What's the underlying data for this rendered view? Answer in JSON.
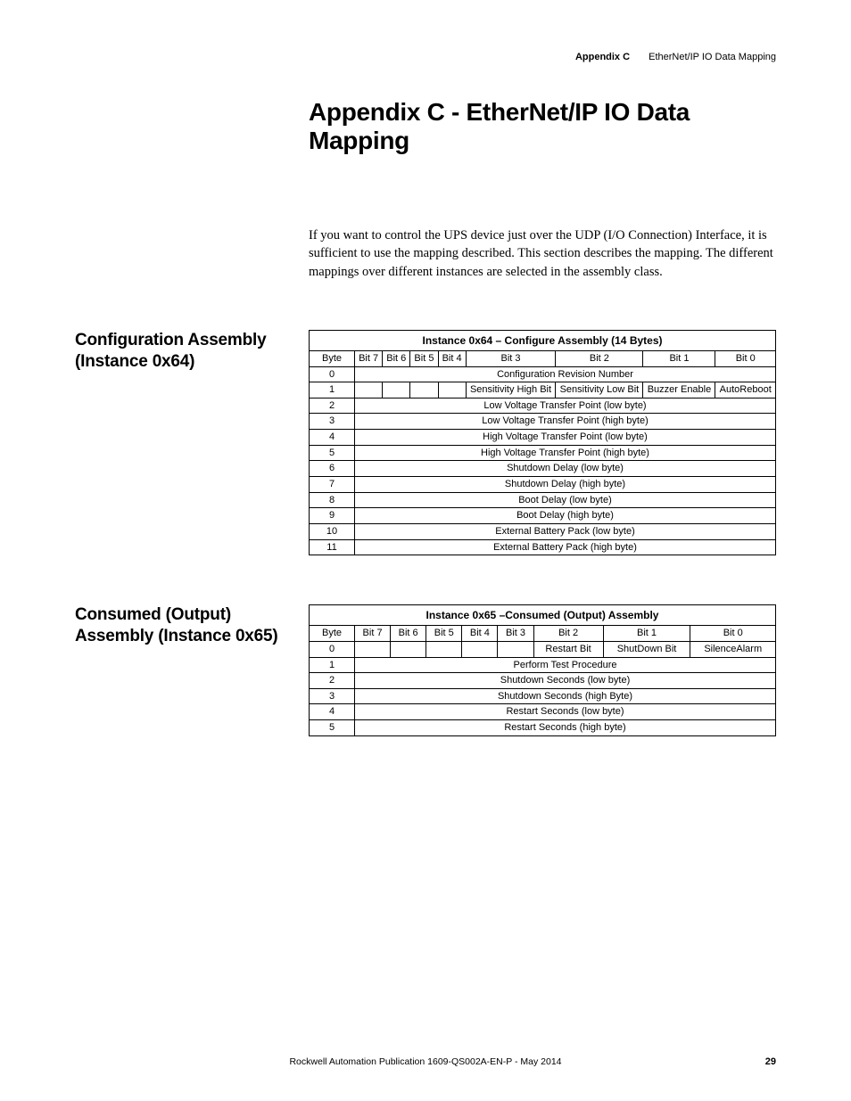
{
  "header": {
    "appendix": "Appendix C",
    "chapter": "EtherNet/IP IO Data Mapping"
  },
  "title": "Appendix C - EtherNet/IP IO Data Mapping",
  "intro": "If you want to control the UPS device just over the UDP (I/O Connection) Interface, it is sufficient to use the mapping described. This section describes the mapping. The different mappings over different instances are selected in the assembly class.",
  "section1": {
    "heading": "Configuration Assembly (Instance 0x64)",
    "table": {
      "caption": "Instance 0x64 – Configure Assembly (14 Bytes)",
      "head": [
        "Byte",
        "Bit 7",
        "Bit 6",
        "Bit 5",
        "Bit 4",
        "Bit 3",
        "Bit 2",
        "Bit 1",
        "Bit 0"
      ],
      "rows": [
        {
          "byte": "0",
          "full": "Configuration Revision Number"
        },
        {
          "byte": "1",
          "cells": [
            "",
            "",
            "",
            "",
            "Sensitivity High Bit",
            "Sensitivity Low Bit",
            "Buzzer Enable",
            "AutoReboot"
          ]
        },
        {
          "byte": "2",
          "full": "Low Voltage Transfer Point (low byte)"
        },
        {
          "byte": "3",
          "full": "Low Voltage Transfer Point (high byte)"
        },
        {
          "byte": "4",
          "full": "High Voltage Transfer Point (low byte)"
        },
        {
          "byte": "5",
          "full": "High Voltage Transfer Point (high byte)"
        },
        {
          "byte": "6",
          "full": "Shutdown Delay (low byte)"
        },
        {
          "byte": "7",
          "full": "Shutdown Delay (high byte)"
        },
        {
          "byte": "8",
          "full": "Boot Delay (low byte)"
        },
        {
          "byte": "9",
          "full": "Boot Delay (high byte)"
        },
        {
          "byte": "10",
          "full": "External Battery Pack (low byte)"
        },
        {
          "byte": "11",
          "full": "External Battery Pack (high byte)"
        }
      ]
    }
  },
  "section2": {
    "heading": "Consumed (Output) Assembly (Instance 0x65)",
    "table": {
      "caption": "Instance 0x65 –Consumed (Output) Assembly",
      "head": [
        "Byte",
        "Bit 7",
        "Bit 6",
        "Bit 5",
        "Bit 4",
        "Bit 3",
        "Bit 2",
        "Bit 1",
        "Bit 0"
      ],
      "rows": [
        {
          "byte": "0",
          "cells": [
            "",
            "",
            "",
            "",
            "",
            "Restart Bit",
            "ShutDown Bit",
            "SilenceAlarm"
          ]
        },
        {
          "byte": "1",
          "full": "Perform Test Procedure"
        },
        {
          "byte": "2",
          "full": "Shutdown Seconds (low byte)"
        },
        {
          "byte": "3",
          "full": "Shutdown Seconds (high Byte)"
        },
        {
          "byte": "4",
          "full": "Restart Seconds (low byte)"
        },
        {
          "byte": "5",
          "full": "Restart Seconds (high byte)"
        }
      ]
    }
  },
  "footer": {
    "pub": "Rockwell Automation Publication 1609-QS002A-EN-P - May 2014",
    "page": "29"
  }
}
